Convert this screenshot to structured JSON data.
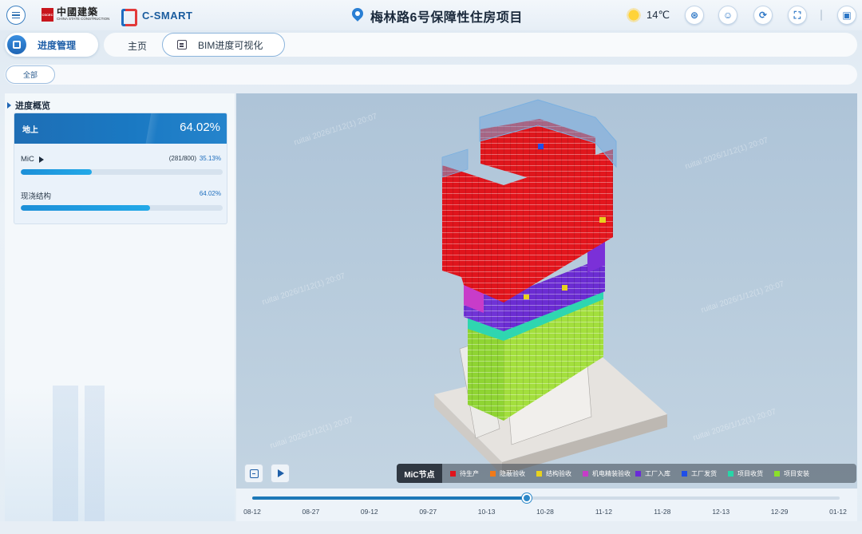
{
  "header": {
    "brand_cn": "中國建築",
    "brand_en": "CHINA STATE CONSTRUCTION",
    "brand_mark": "CSCEC",
    "product": "C-SMART",
    "project_title": "梅林路6号保障性住房项目",
    "temperature": "14℃",
    "weather_icon": "sun-icon",
    "tools": [
      {
        "name": "compass-tool-button",
        "glyph": "⊛"
      },
      {
        "name": "user-tool-button",
        "glyph": "☺"
      },
      {
        "name": "refresh-tool-button",
        "glyph": "⟳"
      },
      {
        "name": "fullscreen-tool-button",
        "glyph": "⛶"
      },
      {
        "name": "app-tool-button",
        "glyph": "▣"
      }
    ]
  },
  "nav": {
    "module_label": "进度管理",
    "tabs": [
      "主页",
      "BIM进度可视化"
    ]
  },
  "filter": {
    "all_label": "全部"
  },
  "overview": {
    "section_title": "进度概览",
    "head_label": "地上",
    "head_pct": "64.02%",
    "rows": [
      {
        "label": "MiC",
        "count": "(281/800)",
        "pct": "35.13%",
        "fraction": 0.3513
      },
      {
        "label": "现浇结构",
        "count": "",
        "pct": "64.02%",
        "fraction": 0.6402
      }
    ]
  },
  "viewer": {
    "watermark": "ruitai 2026/1/12(1) 20:07",
    "legend_title": "MiC节点",
    "legend": [
      {
        "label": "待生产",
        "color": "#e0141c"
      },
      {
        "label": "隐蔽验收",
        "color": "#f07a1a"
      },
      {
        "label": "结构验收",
        "color": "#e8d21e"
      },
      {
        "label": "机电精装验收",
        "color": "#c63cc8"
      },
      {
        "label": "工厂入库",
        "color": "#6a2bd8"
      },
      {
        "label": "工厂发货",
        "color": "#1f4ee8"
      },
      {
        "label": "项目收货",
        "color": "#28d6a8"
      },
      {
        "label": "项目安装",
        "color": "#8be02a"
      }
    ]
  },
  "timeline": {
    "progress_fraction": 0.468,
    "labels": [
      "08-12",
      "08-27",
      "09-12",
      "09-27",
      "10-13",
      "10-28",
      "11-12",
      "11-28",
      "12-13",
      "12-29",
      "01-12"
    ]
  }
}
